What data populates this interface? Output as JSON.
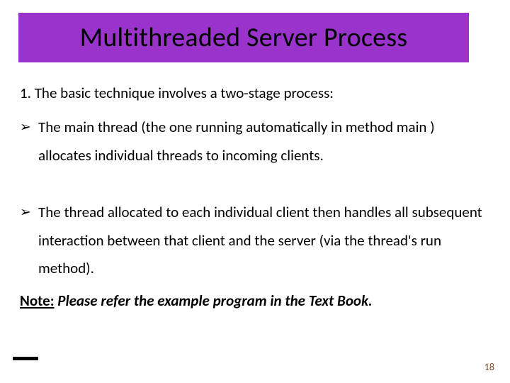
{
  "title": "Multithreaded Server Process",
  "intro": "1. The basic technique involves a two-stage process:",
  "bullets": [
    "The main thread (the one running automatically in method main ) allocates individual threads to incoming clients.",
    "The thread allocated to each individual client then handles all subsequent interaction between that client and the server (via the thread's run method)."
  ],
  "note": {
    "label": "Note:",
    "body": " Please refer the example program in the Text Book."
  },
  "bullet_marker": "➢",
  "page_number": "18"
}
